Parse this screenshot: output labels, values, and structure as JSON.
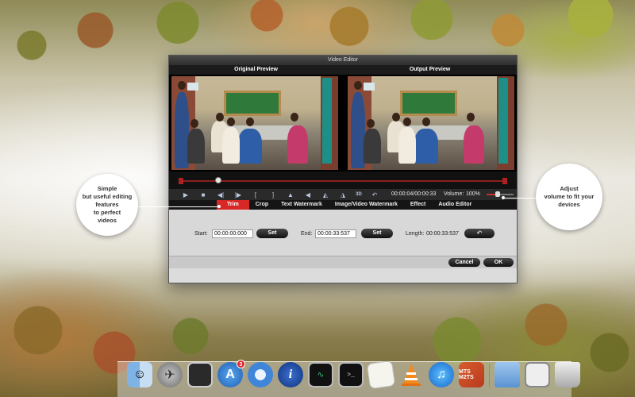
{
  "window": {
    "title": "Video Editor",
    "original_preview_label": "Original Preview",
    "output_preview_label": "Output Preview"
  },
  "player": {
    "time_readout": "00:00:04/00:00:33",
    "volume_label": "Volume:",
    "volume_value": "100%",
    "volume_level": 0.4,
    "playhead_position": 0.12,
    "buttons": [
      "play-icon",
      "stop-icon",
      "rewind-icon",
      "forward-icon",
      "mark-in-icon",
      "mark-out-icon",
      "scene-icon",
      "prev-frame-icon",
      "snapshot-icon",
      "rotate-icon",
      "3d-icon",
      "undo-icon"
    ],
    "three_d_label": "3D"
  },
  "tabs": [
    {
      "label": "Trim",
      "active": true
    },
    {
      "label": "Crop",
      "active": false
    },
    {
      "label": "Text Watermark",
      "active": false
    },
    {
      "label": "Image/Video Watermark",
      "active": false
    },
    {
      "label": "Effect",
      "active": false
    },
    {
      "label": "Audio Editor",
      "active": false
    }
  ],
  "trim": {
    "start_label": "Start:",
    "start_value": "00:00:00:000",
    "end_label": "End:",
    "end_value": "00:00:33:537",
    "set_label": "Set",
    "length_label": "Length:",
    "length_value": "00:00:33:537"
  },
  "footer": {
    "cancel_label": "Cancel",
    "ok_label": "OK"
  },
  "callouts": {
    "left": "Simple\nbut useful editing\nfeatures\nto perfect\nvideos",
    "right": "Adjust\nvolume to fit your\ndevices"
  },
  "dock": {
    "items": [
      "finder-icon",
      "launchpad-icon",
      "photo-booth-icon",
      "app-store-icon",
      "safari-icon",
      "system-info-icon",
      "activity-monitor-icon",
      "terminal-icon",
      "textedit-icon",
      "vlc-icon",
      "itunes-icon",
      "mts-converter-icon",
      "applications-folder-icon",
      "desktop-screenshot-icon",
      "trash-icon"
    ],
    "app_store_badge": "3",
    "mts_label": "MTS M2TS"
  }
}
